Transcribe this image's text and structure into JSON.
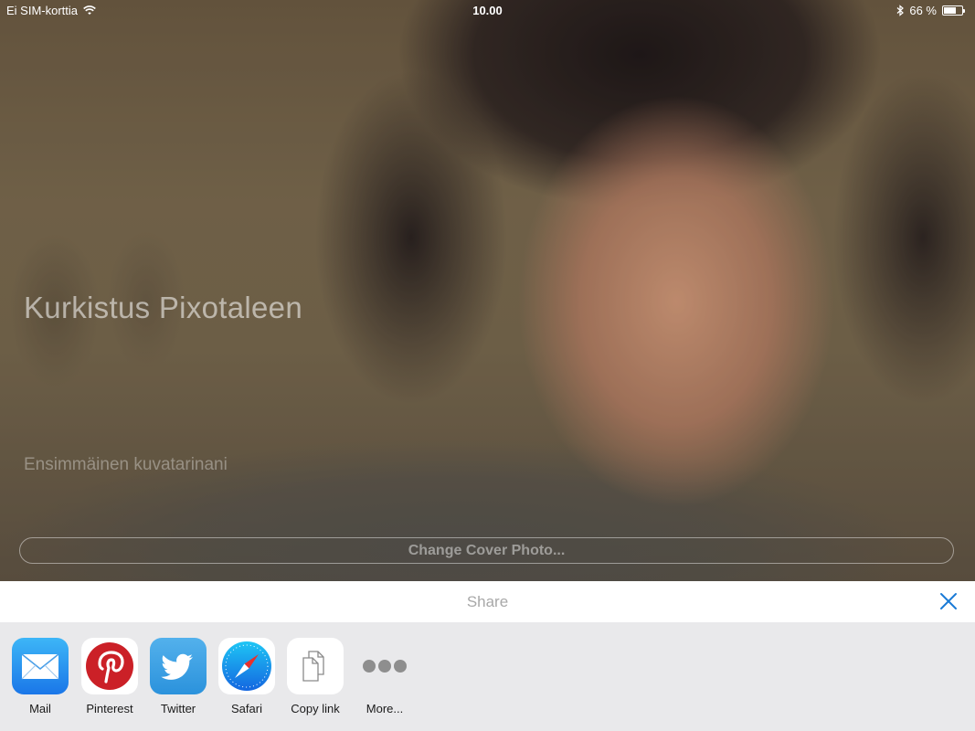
{
  "status_bar": {
    "carrier": "Ei SIM-korttia",
    "time": "10.00",
    "battery_text": "66 %",
    "battery_level": 0.66
  },
  "cover": {
    "title": "Kurkistus Pixotaleen",
    "subtitle": "Ensimmäinen kuvatarinani",
    "change_button": "Change Cover Photo..."
  },
  "share": {
    "title": "Share",
    "close_icon": "close-icon",
    "items": [
      {
        "label": "Mail",
        "icon": "mail-icon"
      },
      {
        "label": "Pinterest",
        "icon": "pinterest-icon"
      },
      {
        "label": "Twitter",
        "icon": "twitter-icon"
      },
      {
        "label": "Safari",
        "icon": "safari-icon"
      },
      {
        "label": "Copy link",
        "icon": "copy-link-icon"
      },
      {
        "label": "More...",
        "icon": "more-icon"
      }
    ]
  },
  "colors": {
    "accent": "#1a7bd6",
    "sheet_background": "#e9e9eb",
    "header_background": "#ffffff"
  }
}
